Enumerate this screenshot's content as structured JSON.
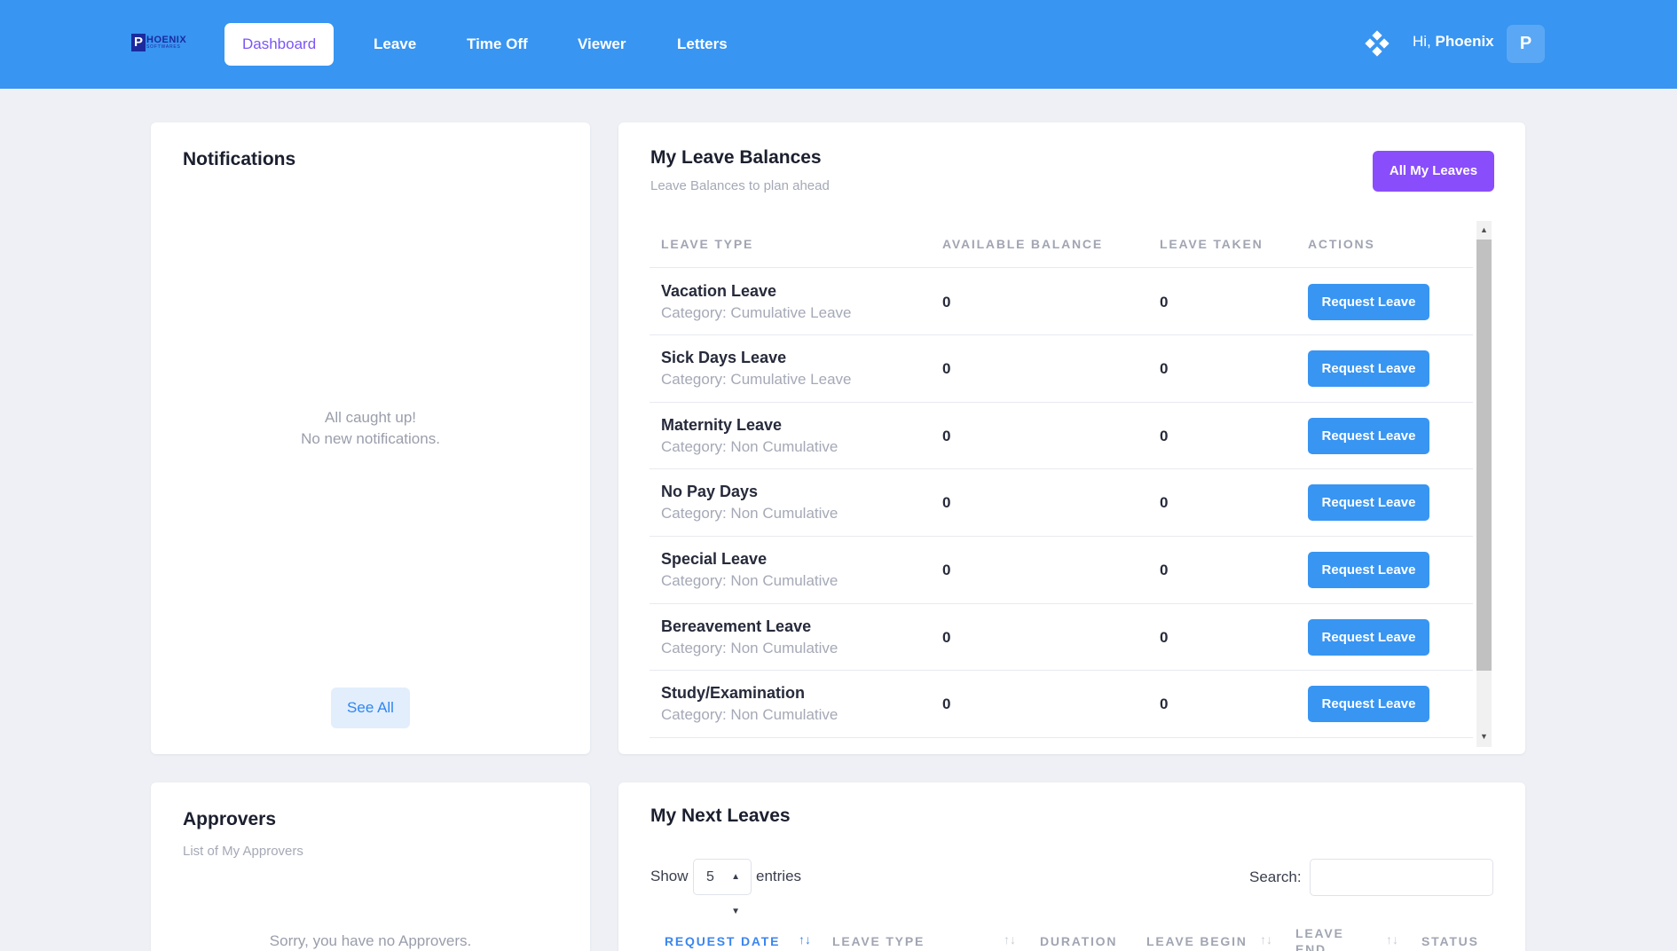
{
  "brand": {
    "logo_letter": "P",
    "logo_word": "HOENIX",
    "logo_sub": "SOFTWARES"
  },
  "nav": {
    "items": [
      {
        "label": "Dashboard",
        "active": true
      },
      {
        "label": "Leave"
      },
      {
        "label": "Time Off"
      },
      {
        "label": "Viewer"
      },
      {
        "label": "Letters"
      }
    ],
    "greeting": "Hi,",
    "user_name": "Phoenix",
    "avatar_letter": "P",
    "apps_icon": "diamond-grid-icon"
  },
  "notifications": {
    "title": "Notifications",
    "empty_line1": "All caught up!",
    "empty_line2": "No new notifications.",
    "see_all": "See All"
  },
  "leave_balances": {
    "title": "My Leave Balances",
    "subtitle": "Leave Balances to plan ahead",
    "all_button": "All My Leaves",
    "columns": [
      "Leave Type",
      "Available Balance",
      "Leave Taken",
      "Actions"
    ],
    "action_label": "Request Leave",
    "rows": [
      {
        "name": "Vacation Leave",
        "category": "Category: Cumulative Leave",
        "available": "0",
        "taken": "0"
      },
      {
        "name": "Sick Days Leave",
        "category": "Category: Cumulative Leave",
        "available": "0",
        "taken": "0"
      },
      {
        "name": "Maternity Leave",
        "category": "Category: Non Cumulative",
        "available": "0",
        "taken": "0"
      },
      {
        "name": "No Pay Days",
        "category": "Category: Non Cumulative",
        "available": "0",
        "taken": "0"
      },
      {
        "name": "Special Leave",
        "category": "Category: Non Cumulative",
        "available": "0",
        "taken": "0"
      },
      {
        "name": "Bereavement Leave",
        "category": "Category: Non Cumulative",
        "available": "0",
        "taken": "0"
      },
      {
        "name": "Study/Examination",
        "category": "Category: Non Cumulative",
        "available": "0",
        "taken": "0"
      }
    ]
  },
  "approvers": {
    "title": "Approvers",
    "subtitle": "List of My Approvers",
    "empty": "Sorry, you have no Approvers."
  },
  "next_leaves": {
    "title": "My Next Leaves",
    "show_label": "Show",
    "entries_value": "5",
    "entries_label": "entries",
    "search_label": "Search:",
    "columns": [
      "Request Date",
      "Leave Type",
      "Duration",
      "Leave Begin",
      "Leave End",
      "Status"
    ]
  },
  "colors": {
    "header": "#3895f2",
    "accent_purple": "#8a4dfb",
    "button_blue": "#3895f2"
  }
}
